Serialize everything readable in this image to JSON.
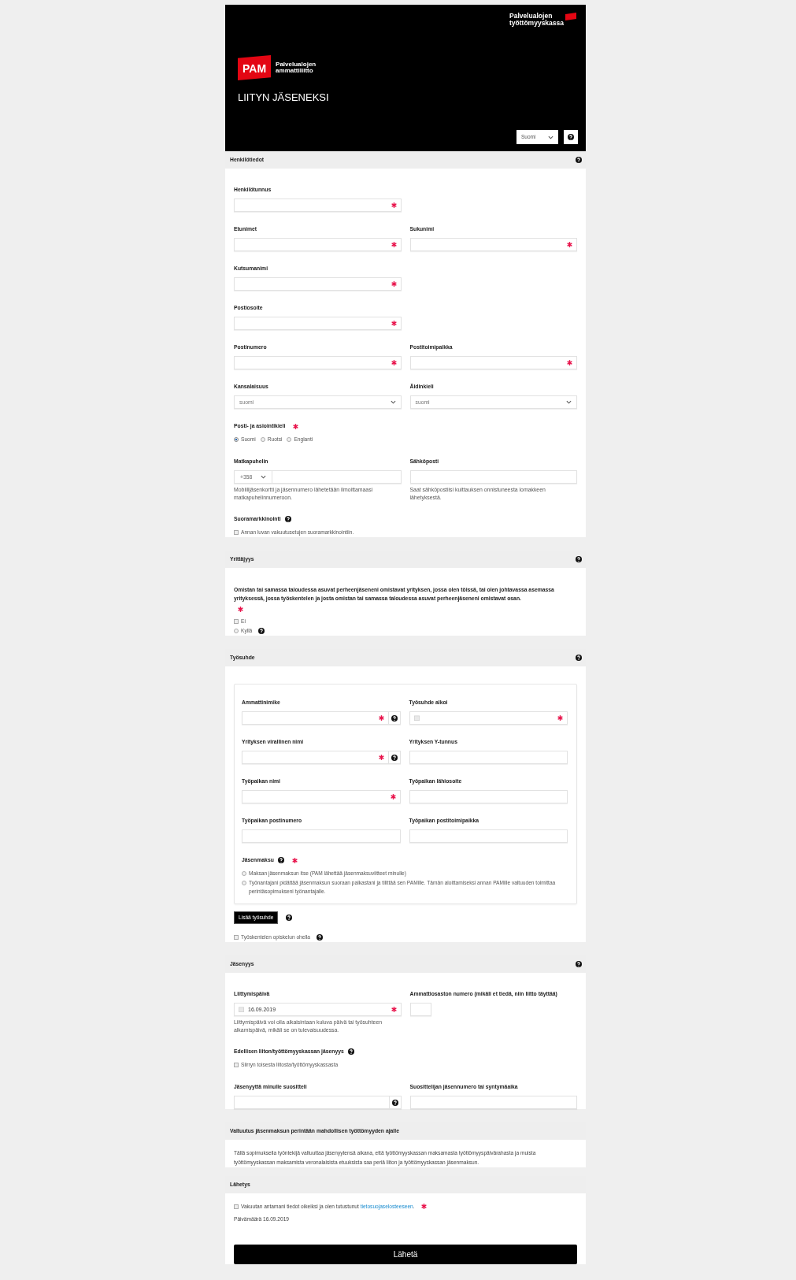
{
  "header": {
    "kassa_logo": {
      "line1": "Palvelualojen",
      "line2": "työttömyyskassa"
    },
    "pam_logo": {
      "mark": "PAM",
      "line1": "Palvelualojen",
      "line2": "ammattiliitto"
    },
    "title": "LIITYN JÄSENEKSI",
    "language": "Suomi",
    "help": true
  },
  "sections": [
    {
      "title": "Henkilötiedot",
      "help": true,
      "blocks": [
        {
          "kind": "fields",
          "fields": [
            {
              "kind": "text",
              "label": "Henkilötunnus",
              "required": true
            }
          ]
        },
        {
          "kind": "fields",
          "fields": [
            {
              "kind": "text",
              "label": "Etunimet",
              "required": true
            },
            {
              "kind": "text",
              "label": "Sukunimi",
              "required": true
            }
          ]
        },
        {
          "kind": "fields",
          "fields": [
            {
              "kind": "text",
              "label": "Kutsumanimi",
              "required": true
            }
          ]
        },
        {
          "kind": "fields",
          "fields": [
            {
              "kind": "text",
              "label": "Postiosoite",
              "required": true
            }
          ]
        },
        {
          "kind": "fields",
          "fields": [
            {
              "kind": "text",
              "label": "Postinumero",
              "required": true
            },
            {
              "kind": "text",
              "label": "Postitoimipaikka",
              "required": true
            }
          ]
        },
        {
          "kind": "fields",
          "fields": [
            {
              "kind": "select",
              "label": "Kansalaisuus",
              "value": "suomi",
              "required": false
            },
            {
              "kind": "select",
              "label": "Äidinkieli",
              "value": "suomi",
              "required": false
            }
          ]
        },
        {
          "kind": "choices",
          "label": "Posti- ja asiointikieli",
          "required": true,
          "inline": true,
          "options": [
            {
              "kind": "radio",
              "label": "Suomi",
              "selected": true
            },
            {
              "kind": "radio",
              "label": "Ruotsi",
              "selected": false
            },
            {
              "kind": "radio",
              "label": "Englanti",
              "selected": false
            }
          ]
        },
        {
          "kind": "fields",
          "fields": [
            {
              "kind": "phone",
              "label": "Matkapuhelin",
              "code": "+358",
              "hint": "Mobiilijäsenkortti ja jäsennumero lähetetään ilmoittamaasi matkapuhelinnumeroon.",
              "required": false
            },
            {
              "kind": "text",
              "label": "Sähköposti",
              "hint": "Saat sähköpostiisi kuittauksen onnistuneesta lomakkeen lähetyksestä.",
              "required": false
            }
          ]
        },
        {
          "kind": "choices",
          "label": "Suoramarkkinointi",
          "required": false,
          "help": true,
          "options": [
            {
              "kind": "checkbox",
              "label": "Annan luvan vakuutusetujen suoramarkkinointiin.",
              "checked": false
            }
          ]
        }
      ]
    },
    {
      "title": "Yrittäjyys",
      "help": true,
      "blocks": [
        {
          "kind": "choices",
          "label": "Omistan tai samassa taloudessa asuvat perheenjäseneni omistavat yrityksen, jossa olen töissä, tai olen johtavassa asemassa yrityksessä, jossa työskentelen ja josta omistan tai samassa taloudessa asuvat perheenjäseneni omistavat osan.",
          "required": true,
          "inline": false,
          "options": [
            {
              "kind": "checkbox",
              "label": "Ei",
              "checked": false
            },
            {
              "kind": "radio",
              "label": "Kyllä",
              "selected": false,
              "help": true
            }
          ]
        }
      ]
    },
    {
      "title": "Työsuhde",
      "help": true,
      "blocks": [
        {
          "kind": "card",
          "blocks": [
            {
              "kind": "fields",
              "fields": [
                {
                  "kind": "text",
                  "label": "Ammattinimike",
                  "required": true,
                  "help": true
                },
                {
                  "kind": "date",
                  "label": "Työsuhde alkoi",
                  "required": true
                }
              ]
            },
            {
              "kind": "fields",
              "fields": [
                {
                  "kind": "text",
                  "label": "Yrityksen virallinen nimi",
                  "required": true,
                  "help": true
                },
                {
                  "kind": "text",
                  "label": "Yrityksen Y-tunnus",
                  "required": false
                }
              ]
            },
            {
              "kind": "fields",
              "fields": [
                {
                  "kind": "text",
                  "label": "Työpaikan nimi",
                  "required": true
                },
                {
                  "kind": "text",
                  "label": "Työpaikan lähiosoite",
                  "required": false
                }
              ]
            },
            {
              "kind": "fields",
              "fields": [
                {
                  "kind": "text",
                  "label": "Työpaikan postinumero",
                  "required": false
                },
                {
                  "kind": "text",
                  "label": "Työpaikan postitoimipaikka",
                  "required": false
                }
              ]
            },
            {
              "kind": "choices",
              "label": "Jäsenmaksu",
              "required": true,
              "help": true,
              "inline": false,
              "options": [
                {
                  "kind": "radio",
                  "label": "Maksan jäsenmaksun itse (PAM lähettää jäsenmaksuviitteet minulle)",
                  "selected": false
                },
                {
                  "kind": "radio",
                  "label": "Työnantajani pidättää jäsenmaksun suoraan palkastani ja tilittää sen PAMille. Tämän aloittamiseksi annan PAMille valtuuden toimittaa perintäsopimukseni työnantajalle.",
                  "selected": false
                }
              ]
            }
          ]
        },
        {
          "kind": "button",
          "label": "Lisää työsuhde",
          "help": true
        },
        {
          "kind": "choices",
          "required": false,
          "options": [
            {
              "kind": "checkbox",
              "label": "Työskentelen opiskelun ohella",
              "checked": false,
              "help": true
            }
          ]
        }
      ]
    },
    {
      "title": "Jäsenyys",
      "help": true,
      "blocks": [
        {
          "kind": "fields",
          "fields": [
            {
              "kind": "date",
              "label": "Liittymispäivä",
              "value": "16.09.2019",
              "hint": "Liittymispäivä voi olla aikaisintaan kuluva päivä tai työsuhteen alkamispäivä, mikäli se on tulevaisuudessa.",
              "required": true
            },
            {
              "kind": "short_text",
              "label": "Ammattiosaston numero (mikäli et tiedä, niin liitto täyttää)",
              "required": false
            }
          ]
        },
        {
          "kind": "choices",
          "label": "Edellisen liiton/työttömyyskassan jäsenyys",
          "required": false,
          "help": true,
          "options": [
            {
              "kind": "checkbox",
              "label": "Siirryn toisesta liitosta/työttömyyskassasta",
              "checked": false
            }
          ]
        },
        {
          "kind": "fields",
          "fields": [
            {
              "kind": "text",
              "label": "Jäsenyyttä minulle suositteli",
              "required": false,
              "help": true
            },
            {
              "kind": "text",
              "label": "Suosittelijan jäsennumero tai syntymäaika",
              "required": false
            }
          ]
        }
      ]
    },
    {
      "title": "Valtuutus jäsenmaksun perintään mahdollisen työttömyyden ajalle",
      "blocks": [
        {
          "kind": "paragraph",
          "text": "Tällä sopimuksella työntekijä valtuuttaa jäsenyytensä aikana, että työttömyyskassan maksamasta työttömyyspäivärahasta ja muista työttömyyskassan maksamista veronalaisista etuuksista saa periä liiton ja työttömyyskassan jäsenmaksun."
        }
      ]
    },
    {
      "title": "Lähetys",
      "blocks": [
        {
          "kind": "consent",
          "text": "Vakuutan antamani tiedot oikeiksi ja olen tutustunut",
          "link": "tietosuojaselosteeseen",
          "after": ".",
          "required": true,
          "checked": false
        },
        {
          "kind": "paragraph",
          "text": "Päivämäärä 16.09.2019"
        },
        {
          "kind": "submit",
          "label": "Lähetä"
        }
      ]
    }
  ]
}
